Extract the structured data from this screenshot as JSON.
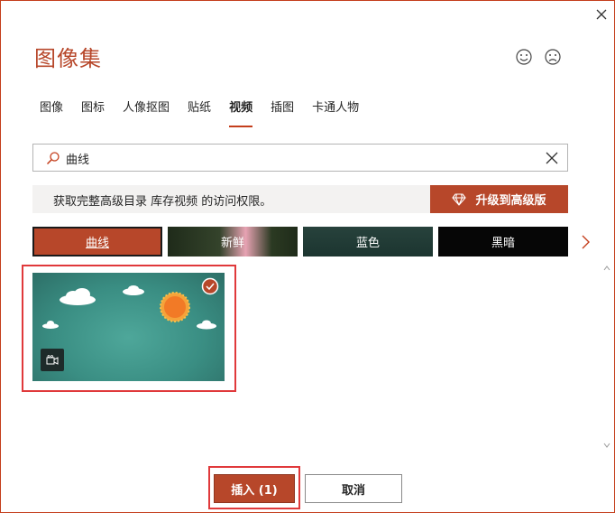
{
  "dialog": {
    "title": "图像集",
    "close_icon": "close-icon",
    "feedback": {
      "smile_icon": "smile-icon",
      "frown_icon": "frown-icon"
    }
  },
  "tabs": [
    {
      "label": "图像",
      "active": false
    },
    {
      "label": "图标",
      "active": false
    },
    {
      "label": "人像抠图",
      "active": false
    },
    {
      "label": "贴纸",
      "active": false
    },
    {
      "label": "视频",
      "active": true
    },
    {
      "label": "插图",
      "active": false
    },
    {
      "label": "卡通人物",
      "active": false
    }
  ],
  "search": {
    "value": "曲线",
    "placeholder": ""
  },
  "banner": {
    "text": "获取完整高级目录 库存视频 的访问权限。",
    "upgrade_label": "升级到高级版"
  },
  "categories": [
    {
      "label": "曲线",
      "selected": true
    },
    {
      "label": "新鲜",
      "selected": false
    },
    {
      "label": "蓝色",
      "selected": false
    },
    {
      "label": "黑暗",
      "selected": false
    }
  ],
  "results": [
    {
      "kind": "video",
      "selected": true,
      "description_icon": "video-camera-icon"
    }
  ],
  "footer": {
    "insert_label": "插入 (1)",
    "cancel_label": "取消"
  },
  "colors": {
    "accent": "#b7472a",
    "highlight_frame": "#e0393b",
    "banner_bg": "#f3f2f1"
  }
}
